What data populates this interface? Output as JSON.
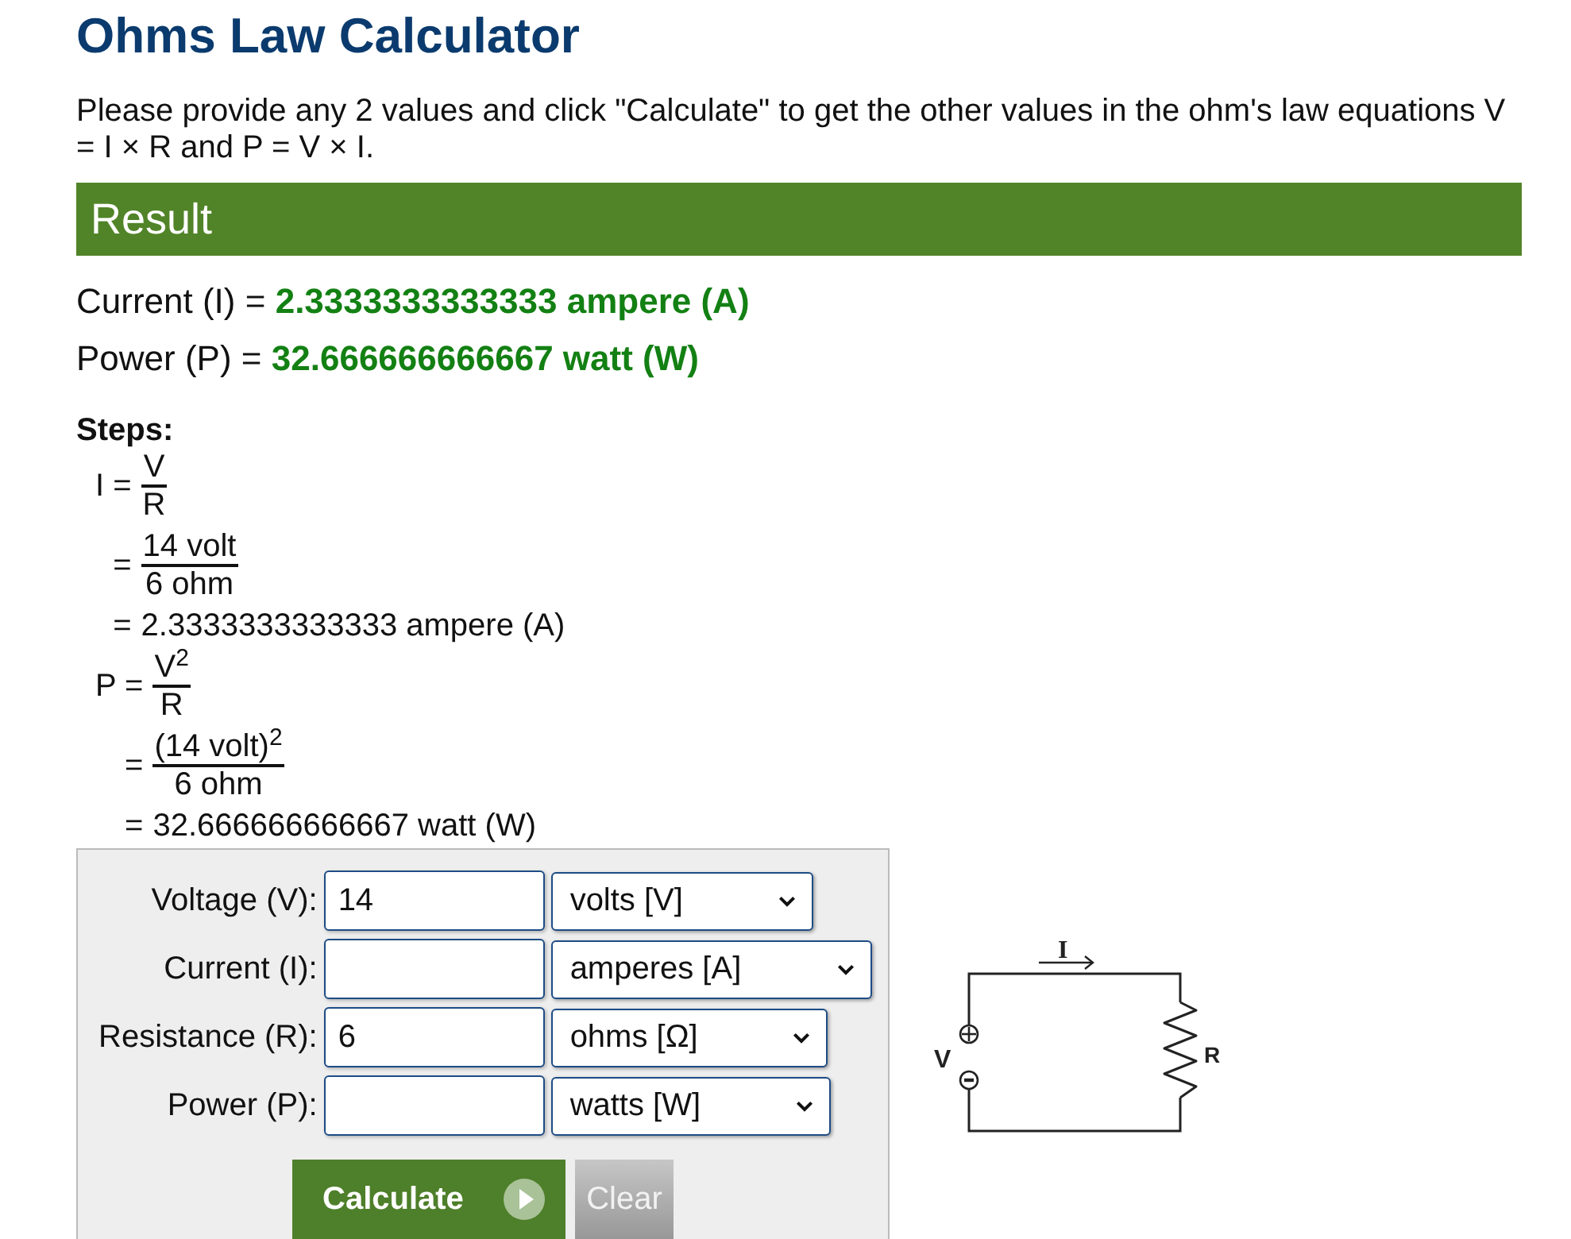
{
  "title": "Ohms Law Calculator",
  "intro": "Please provide any 2 values and click \"Calculate\" to get the other values in the ohm's law equations V = I × R and P = V × I.",
  "result": {
    "heading": "Result",
    "lines": [
      {
        "label": "Current (I) =",
        "value": "2.3333333333333 ampere (A)"
      },
      {
        "label": "Power (P) =",
        "value": "32.666666666667 watt (W)"
      }
    ]
  },
  "steps": {
    "heading": "Steps:",
    "groups": [
      {
        "lines": [
          {
            "kind": "fraction",
            "lead": "I =",
            "numerator": "V",
            "denominator": "R"
          },
          {
            "kind": "fraction",
            "lead": "=",
            "numerator": "14 volt",
            "denominator": "6 ohm"
          },
          {
            "kind": "text",
            "lead": "=",
            "text": "2.3333333333333 ampere (A)"
          }
        ]
      },
      {
        "lines": [
          {
            "kind": "fraction",
            "lead": "P =",
            "numerator": "V$^{2}$",
            "denominator": "R"
          },
          {
            "kind": "fraction",
            "lead": "=",
            "numerator": "(14 volt)$^{2}$",
            "denominator": "6 ohm"
          },
          {
            "kind": "text",
            "lead": "=",
            "text": "32.666666666667 watt (W)"
          }
        ]
      }
    ]
  },
  "form": {
    "rows": [
      {
        "label": "Voltage (V):",
        "value": "14",
        "unit": "volts [V]"
      },
      {
        "label": "Current (I):",
        "unit": "amperes [A]"
      },
      {
        "label": "Resistance (R):",
        "value": "6",
        "unit": "ohms [Ω]"
      },
      {
        "label": "Power (P):",
        "unit": "watts [W]"
      }
    ],
    "buttons": [
      {
        "kind": "primary",
        "label": "Calculate"
      },
      {
        "kind": "secondary",
        "label": "Clear"
      }
    ]
  },
  "diagram": {
    "current_label": "I",
    "voltage_label": "V",
    "resistance_label": "R"
  }
}
